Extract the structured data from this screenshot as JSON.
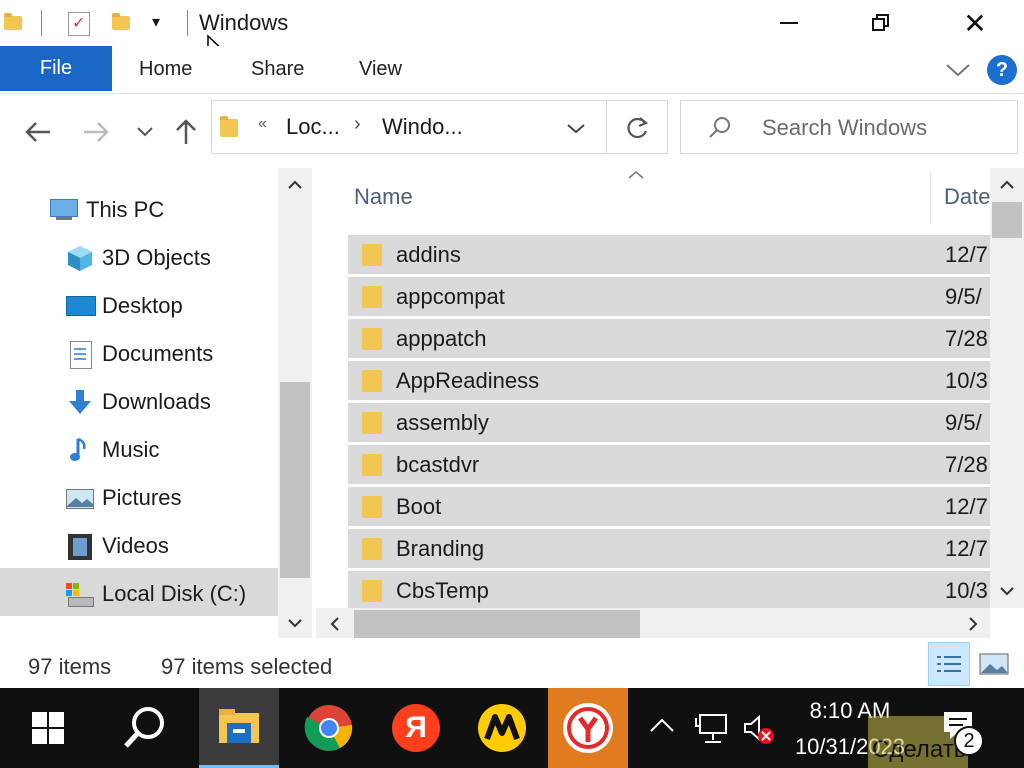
{
  "window": {
    "title": "Windows"
  },
  "ribbon": {
    "file": "File",
    "tabs": [
      "Home",
      "Share",
      "View"
    ],
    "help": "?"
  },
  "address": {
    "ellipsis": "«",
    "crumbs": [
      "Loc...",
      "Windo..."
    ]
  },
  "search": {
    "placeholder": "Search Windows"
  },
  "nav_pane": {
    "items": [
      {
        "label": "This PC",
        "icon": "this-pc-icon"
      },
      {
        "label": "3D Objects",
        "icon": "3d-objects-icon"
      },
      {
        "label": "Desktop",
        "icon": "desktop-icon"
      },
      {
        "label": "Documents",
        "icon": "documents-icon"
      },
      {
        "label": "Downloads",
        "icon": "downloads-icon"
      },
      {
        "label": "Music",
        "icon": "music-icon"
      },
      {
        "label": "Pictures",
        "icon": "pictures-icon"
      },
      {
        "label": "Videos",
        "icon": "videos-icon"
      },
      {
        "label": "Local Disk (C:)",
        "icon": "local-disk-icon"
      }
    ]
  },
  "columns": {
    "name": "Name",
    "date": "Date"
  },
  "files": [
    {
      "name": "addins",
      "date": "12/7"
    },
    {
      "name": "appcompat",
      "date": "9/5/"
    },
    {
      "name": "apppatch",
      "date": "7/28"
    },
    {
      "name": "AppReadiness",
      "date": "10/3"
    },
    {
      "name": "assembly",
      "date": "9/5/"
    },
    {
      "name": "bcastdvr",
      "date": "7/28"
    },
    {
      "name": "Boot",
      "date": "12/7"
    },
    {
      "name": "Branding",
      "date": "12/7"
    },
    {
      "name": "CbsTemp",
      "date": "10/3"
    }
  ],
  "status": {
    "count": "97 items",
    "selected": "97 items selected"
  },
  "taskbar": {
    "time": "8:10 AM",
    "date": "10/31/2023",
    "notification_count": "2",
    "overlay_text": "Сделать"
  },
  "colors": {
    "accent": "#1966c5",
    "selected_row": "#d9d9d9",
    "taskbar": "#101010"
  }
}
